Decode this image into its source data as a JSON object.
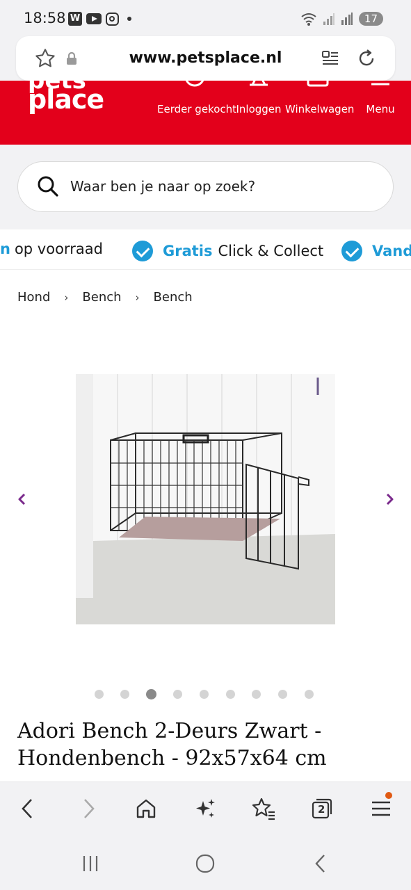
{
  "status_bar": {
    "time": "18:58",
    "battery": "17",
    "signal_labels": [
      "5",
      "R"
    ]
  },
  "browser": {
    "url": "www.petsplace.nl",
    "toolbar_tab_count": "2"
  },
  "site": {
    "brand_color": "#e3001b",
    "logo_text": "place",
    "logo_top_text": "pets",
    "nav": [
      {
        "label": "Eerder gekocht"
      },
      {
        "label": "Inloggen"
      },
      {
        "label": "Winkelwagen"
      },
      {
        "label": "Menu"
      }
    ]
  },
  "search": {
    "placeholder": "Waar ben je naar op zoek?"
  },
  "usps": [
    {
      "strong": "",
      "text": "op voorraad",
      "partial_prefix": "n"
    },
    {
      "strong": "Gratis",
      "text": "Click & Collect"
    },
    {
      "strong": "Vanda",
      "text": ""
    }
  ],
  "usp_accent": "#1e9bd7",
  "breadcrumb": [
    "Hond",
    "Bench",
    "Bench"
  ],
  "carousel": {
    "total_images": 9,
    "active_index": 2,
    "accent": "#7a2a8c"
  },
  "product": {
    "title": "Adori Bench 2-Deurs Zwart - Hondenbench - 92x57x64 cm"
  }
}
